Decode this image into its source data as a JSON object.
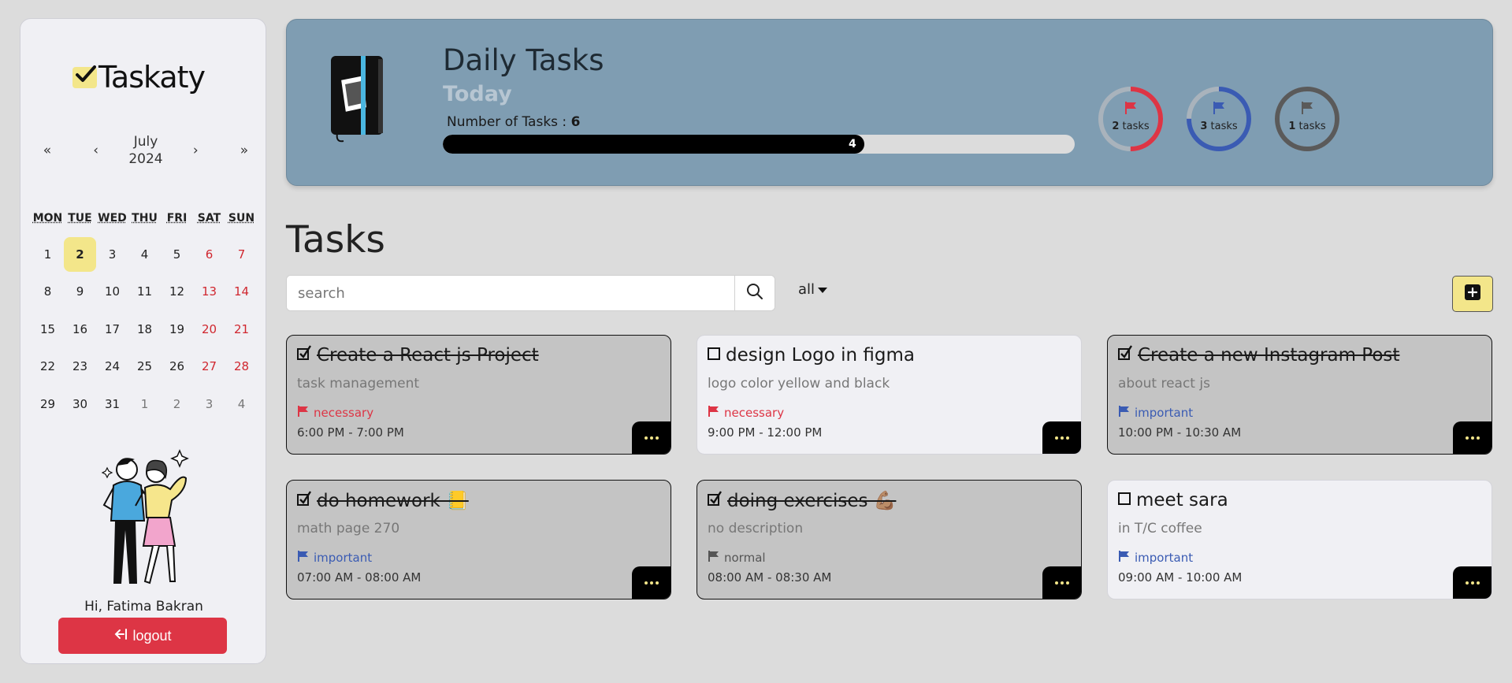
{
  "app": {
    "name": "Taskaty"
  },
  "calendar": {
    "month": "July",
    "year": "2024",
    "nav": {
      "prev_year": "«",
      "prev_month": "‹",
      "next_month": "›",
      "next_year": "»"
    },
    "weekdays": [
      "MON",
      "TUE",
      "WED",
      "THU",
      "FRI",
      "SAT",
      "SUN"
    ],
    "weeks": [
      [
        "1",
        "2",
        "3",
        "4",
        "5",
        "6",
        "7"
      ],
      [
        "8",
        "9",
        "10",
        "11",
        "12",
        "13",
        "14"
      ],
      [
        "15",
        "16",
        "17",
        "18",
        "19",
        "20",
        "21"
      ],
      [
        "22",
        "23",
        "24",
        "25",
        "26",
        "27",
        "28"
      ],
      [
        "29",
        "30",
        "31",
        "1",
        "2",
        "3",
        "4"
      ]
    ],
    "selected": "2"
  },
  "user": {
    "greeting": "Hi, Fatima Bakran"
  },
  "logout": {
    "label": "logout",
    "icon": "logout-arrow-icon"
  },
  "banner": {
    "title": "Daily Tasks",
    "subtitle": "Today",
    "count_label": "Number of Tasks : ",
    "count_value": "6",
    "progress_value": "4",
    "progress_fraction": 0.6667,
    "rings": [
      {
        "count": "2",
        "unit": "tasks",
        "color": "#dd3545",
        "fraction": 0.5
      },
      {
        "count": "3",
        "unit": "tasks",
        "color": "#3a5bb3",
        "fraction": 0.75
      },
      {
        "count": "1",
        "unit": "tasks",
        "color": "#5a5a5a",
        "fraction": 1.0
      }
    ]
  },
  "tasks": {
    "heading": "Tasks",
    "search_placeholder": "search",
    "filter_label": "all",
    "items": [
      {
        "title": "Create a React js Project",
        "desc": "task management",
        "priority": "necessary",
        "time": "6:00 PM - 7:00 PM",
        "done": true
      },
      {
        "title": "design Logo in figma",
        "desc": "logo color yellow and black",
        "priority": "necessary",
        "time": "9:00 PM - 12:00 PM",
        "done": false
      },
      {
        "title": "Create a new Instagram Post",
        "desc": "about react js",
        "priority": "important",
        "time": "10:00 PM - 10:30 AM",
        "done": true
      },
      {
        "title": "do homework 📒",
        "desc": "math page 270",
        "priority": "important",
        "time": "07:00 AM - 08:00 AM",
        "done": true
      },
      {
        "title": "doing exercises 💪🏽",
        "desc": "no description",
        "priority": "normal",
        "time": "08:00 AM - 08:30 AM",
        "done": true
      },
      {
        "title": "meet sara",
        "desc": "in T/C coffee",
        "priority": "important",
        "time": "09:00 AM - 10:00 AM",
        "done": false
      }
    ]
  },
  "colors": {
    "accent_yellow": "#f3e68a",
    "banner": "#7f9db2",
    "logout_red": "#dd3545",
    "necessary": "#dd3545",
    "important": "#3a5bb3",
    "normal": "#555555"
  }
}
